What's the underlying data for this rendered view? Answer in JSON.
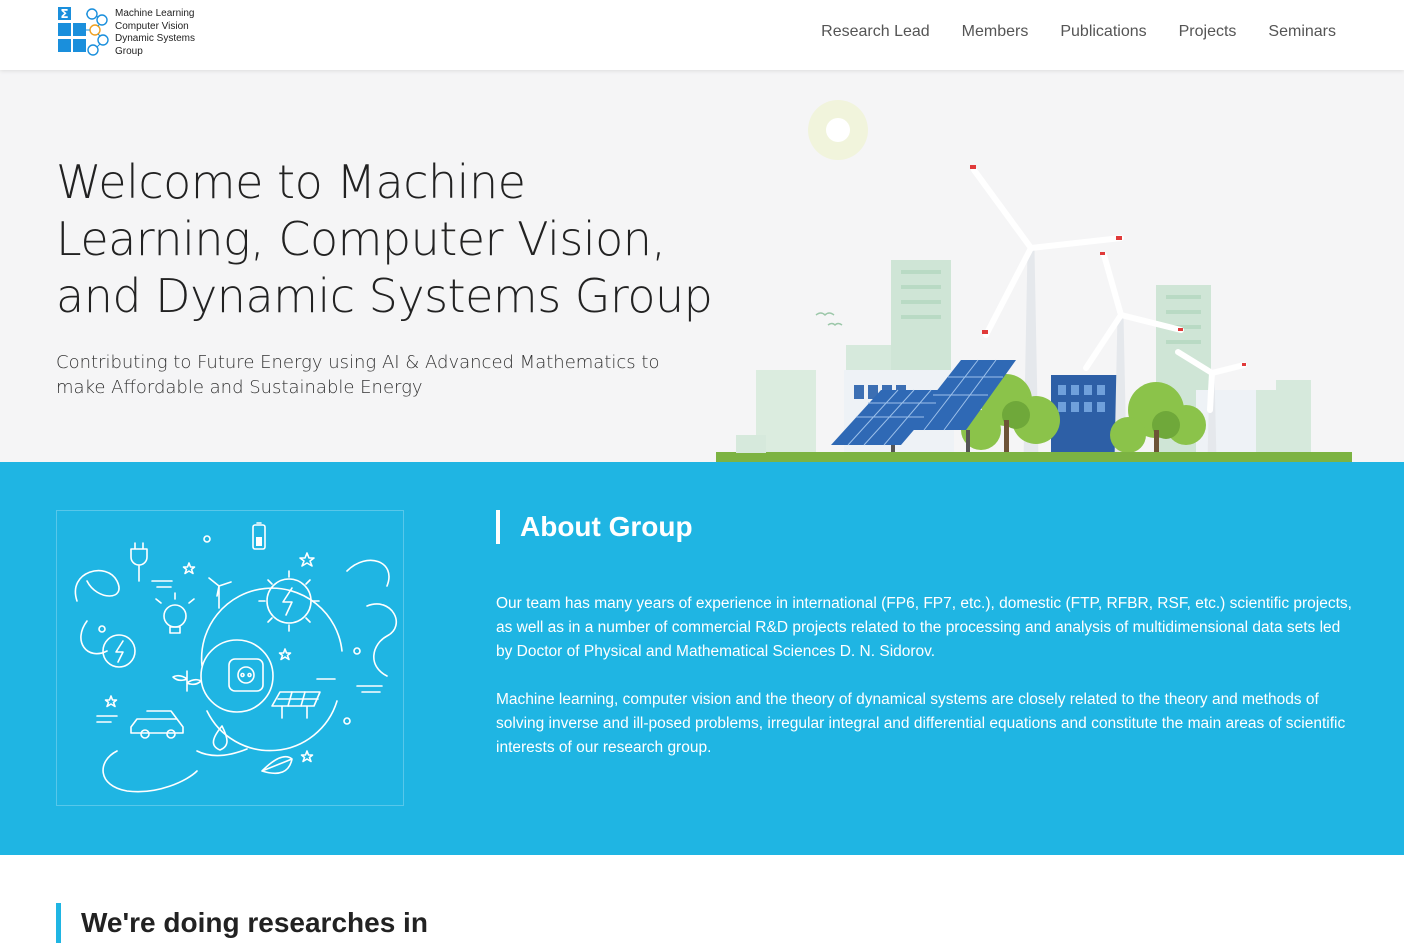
{
  "logo": {
    "lines": [
      "Machine Learning",
      "Computer Vision",
      "Dynamic Systems",
      "Group"
    ],
    "brand_color": "#1a8fdc"
  },
  "nav": {
    "items": [
      "Research Lead",
      "Members",
      "Publications",
      "Projects",
      "Seminars"
    ]
  },
  "hero": {
    "title": "Welcome to Machine Learning, Computer Vision, and Dynamic Systems Group",
    "subtitle": "Contributing to Future Energy using AI & Advanced Mathematics to make Affordable and Sustainable Energy",
    "illustration": "wind-turbines-solar-panels-city-illustration",
    "background": "#f5f5f6"
  },
  "about": {
    "heading": "About Group",
    "paragraph1": "Our team has many years of experience in international (FP6, FP7, etc.), domestic (FTP, RFBR, RSF, etc.) scientific projects, as well as in a number of commercial R&D projects related to the processing and analysis of multidimensional data sets led by Doctor of Physical and Mathematical Sciences D. N. Sidorov.",
    "paragraph2": "Machine learning, computer vision and the theory of dynamical systems are closely related to the theory and methods of solving inverse and ill-posed problems, irregular integral and differential equations and constitute the main areas of scientific interests of our research group.",
    "illustration": "renewable-energy-line-icons-illustration",
    "background": "#1fb5e3"
  },
  "research": {
    "heading": "We're doing researches in"
  }
}
